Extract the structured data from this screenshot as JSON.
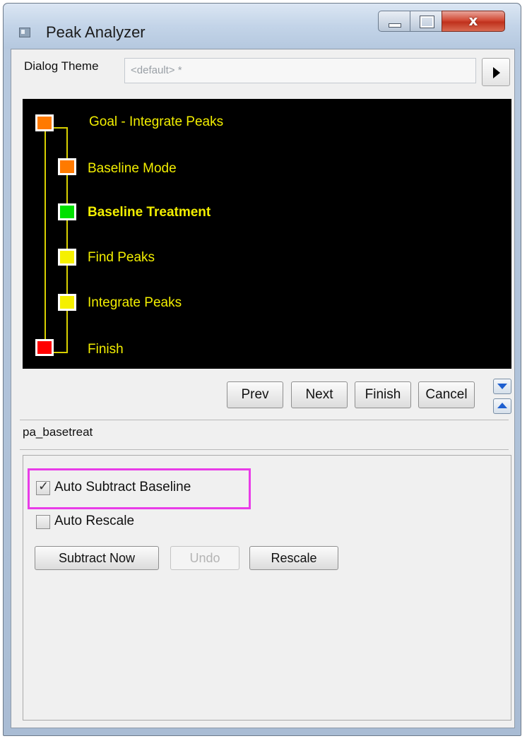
{
  "window": {
    "title": "Peak Analyzer",
    "close_glyph": "x"
  },
  "theme": {
    "label": "Dialog Theme",
    "value": "<default> *",
    "arrow_icon": "right-triangle"
  },
  "flow": {
    "line_color": "#d8d000",
    "steps": [
      {
        "label": "Goal - Integrate Peaks",
        "color": "#ff7a00",
        "bold": false
      },
      {
        "label": "Baseline Mode",
        "color": "#ff7a00",
        "bold": false
      },
      {
        "label": "Baseline Treatment",
        "color": "#00e000",
        "bold": true
      },
      {
        "label": "Find Peaks",
        "color": "#f5f000",
        "bold": false
      },
      {
        "label": "Integrate Peaks",
        "color": "#f5f000",
        "bold": false
      },
      {
        "label": "Finish",
        "color": "#ff0000",
        "bold": false
      }
    ]
  },
  "nav": {
    "prev": "Prev",
    "next": "Next",
    "finish": "Finish",
    "cancel": "Cancel"
  },
  "section": {
    "name": "pa_basetreat"
  },
  "settings": {
    "auto_subtract": {
      "label": "Auto Subtract Baseline",
      "checked": true,
      "check_glyph": "✓"
    },
    "auto_rescale": {
      "label": "Auto Rescale",
      "checked": false
    },
    "subtract_now": "Subtract Now",
    "undo": "Undo",
    "rescale": "Rescale"
  }
}
